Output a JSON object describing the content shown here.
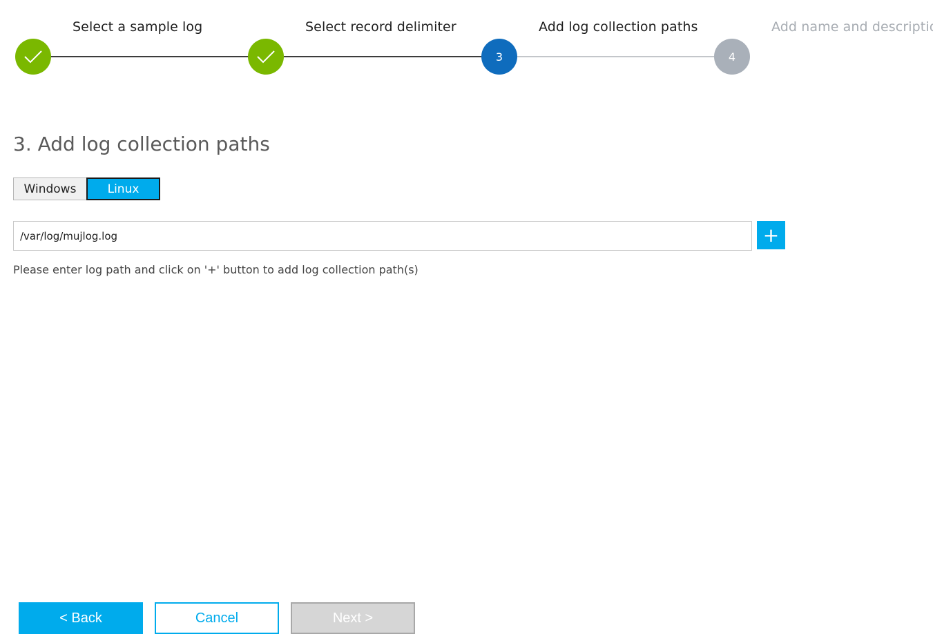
{
  "stepper": {
    "steps": [
      {
        "title": "Select a sample log",
        "state": "completed",
        "marker": "check-icon",
        "number": ""
      },
      {
        "title": "Select record delimiter",
        "state": "completed",
        "marker": "check-icon",
        "number": ""
      },
      {
        "title": "Add log collection paths",
        "state": "active",
        "marker": "number",
        "number": "3"
      },
      {
        "title": "Add name and descriptio",
        "state": "pending",
        "marker": "number",
        "number": "4"
      }
    ],
    "colors": {
      "completed": "#7ab800",
      "active": "#0f6cbd",
      "pending": "#a9b0b9"
    }
  },
  "main": {
    "title": "3. Add log collection paths",
    "os_toggle": {
      "options": [
        "Windows",
        "Linux"
      ],
      "selected": "Linux"
    },
    "path_input": {
      "value": "/var/log/mujlog.log",
      "placeholder": ""
    },
    "add_button_label": "+",
    "hint": "Please enter log path and click on '+' button to add log collection path(s)"
  },
  "footer": {
    "back_label": "< Back",
    "cancel_label": "Cancel",
    "next_label": "Next >",
    "next_enabled": false
  },
  "accent_color": "#00abec"
}
